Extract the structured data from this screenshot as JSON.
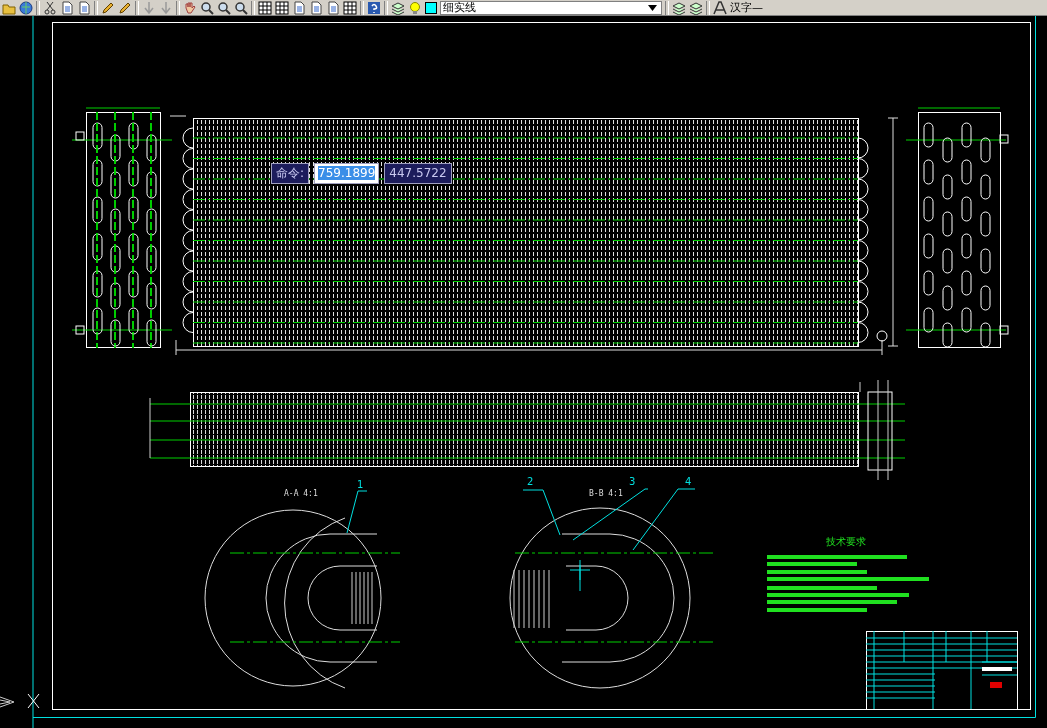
{
  "toolbar": {
    "layer_linetype": "细实线",
    "text_style": "汉字—"
  },
  "command_tooltip": {
    "label": "命令:",
    "x_value": "759.1899",
    "y_value": "447.5722"
  },
  "drawing": {
    "section_labels": [
      "A-A  4:1",
      "B-B  4:1"
    ],
    "callouts": [
      "1",
      "2",
      "3",
      "4"
    ],
    "notes_title": "技术要求"
  }
}
